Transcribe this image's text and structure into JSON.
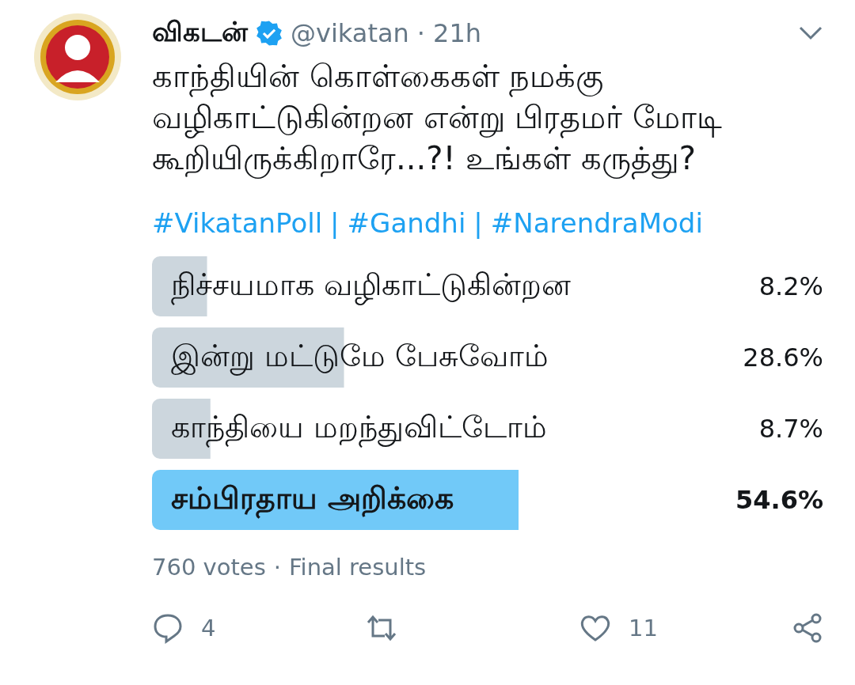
{
  "author": {
    "name": "விகடன்",
    "verified": true,
    "handle": "@vikatan",
    "time_separator": "·",
    "time": "21h"
  },
  "text_lines": [
    "காந்தியின் கொள்கைகள் நமக்கு",
    "வழிகாட்டுகின்றன என்று பிரதமர் மோடி",
    "கூறியிருக்கிறாரே...?! உங்கள் கருத்து?"
  ],
  "hashtags": [
    "#VikatanPoll",
    "#Gandhi",
    "#NarendraModi"
  ],
  "hashtag_separator": "|",
  "poll": {
    "options": [
      {
        "label": "நிச்சயமாக வழிகாட்டுகின்றன",
        "percent": "8.2%",
        "winner": false
      },
      {
        "label": "இன்று மட்டுமே பேசுவோம்",
        "percent": "28.6%",
        "winner": false
      },
      {
        "label": "காந்தியை மறந்துவிட்டோம்",
        "percent": "8.7%",
        "winner": false
      },
      {
        "label": "சம்பிரதாய அறிக்கை",
        "percent": "54.6%",
        "winner": true
      }
    ],
    "votes": "760 votes",
    "meta_separator": "·",
    "status": "Final results"
  },
  "actions": {
    "replies": "4",
    "likes": "11"
  }
}
